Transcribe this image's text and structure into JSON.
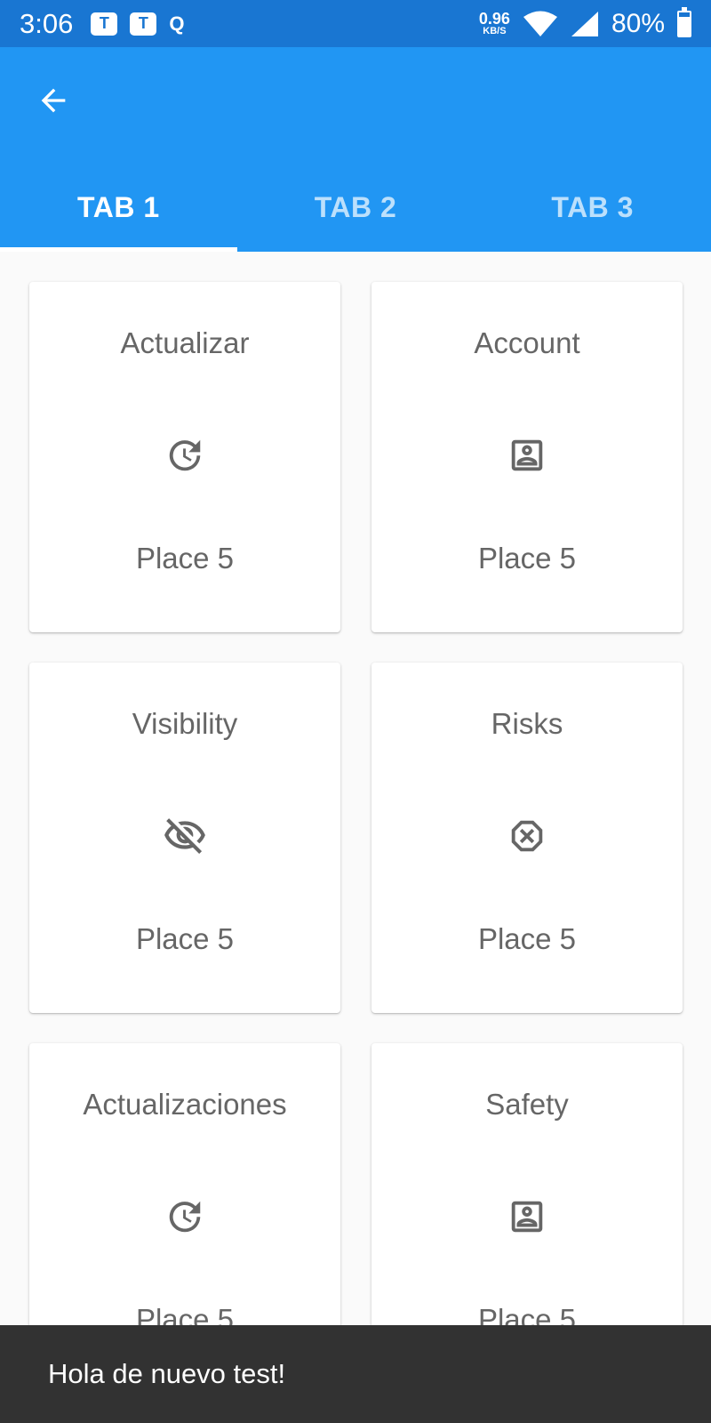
{
  "status_bar": {
    "time": "3:06",
    "notif_teams": "T",
    "notif_q": "Q",
    "net_speed_value": "0.96",
    "net_speed_unit": "KB/S",
    "battery": "80%"
  },
  "tabs": [
    {
      "label": "TAB 1",
      "active": true
    },
    {
      "label": "TAB 2",
      "active": false
    },
    {
      "label": "TAB 3",
      "active": false
    }
  ],
  "cards": [
    {
      "title": "Actualizar",
      "icon": "update-icon",
      "subtitle": "Place 5"
    },
    {
      "title": "Account",
      "icon": "account-box-icon",
      "subtitle": "Place 5"
    },
    {
      "title": "Visibility",
      "icon": "visibility-off-icon",
      "subtitle": "Place 5"
    },
    {
      "title": "Risks",
      "icon": "cancel-octagon-icon",
      "subtitle": "Place 5"
    },
    {
      "title": "Actualizaciones",
      "icon": "update-icon",
      "subtitle": "Place 5"
    },
    {
      "title": "Safety",
      "icon": "account-box-icon",
      "subtitle": "Place 5"
    }
  ],
  "snackbar": {
    "message": "Hola de nuevo test!"
  },
  "colors": {
    "status_bar": "#1976d2",
    "app_bar": "#2196f3",
    "card_text": "#666666",
    "snackbar_bg": "#323232"
  }
}
